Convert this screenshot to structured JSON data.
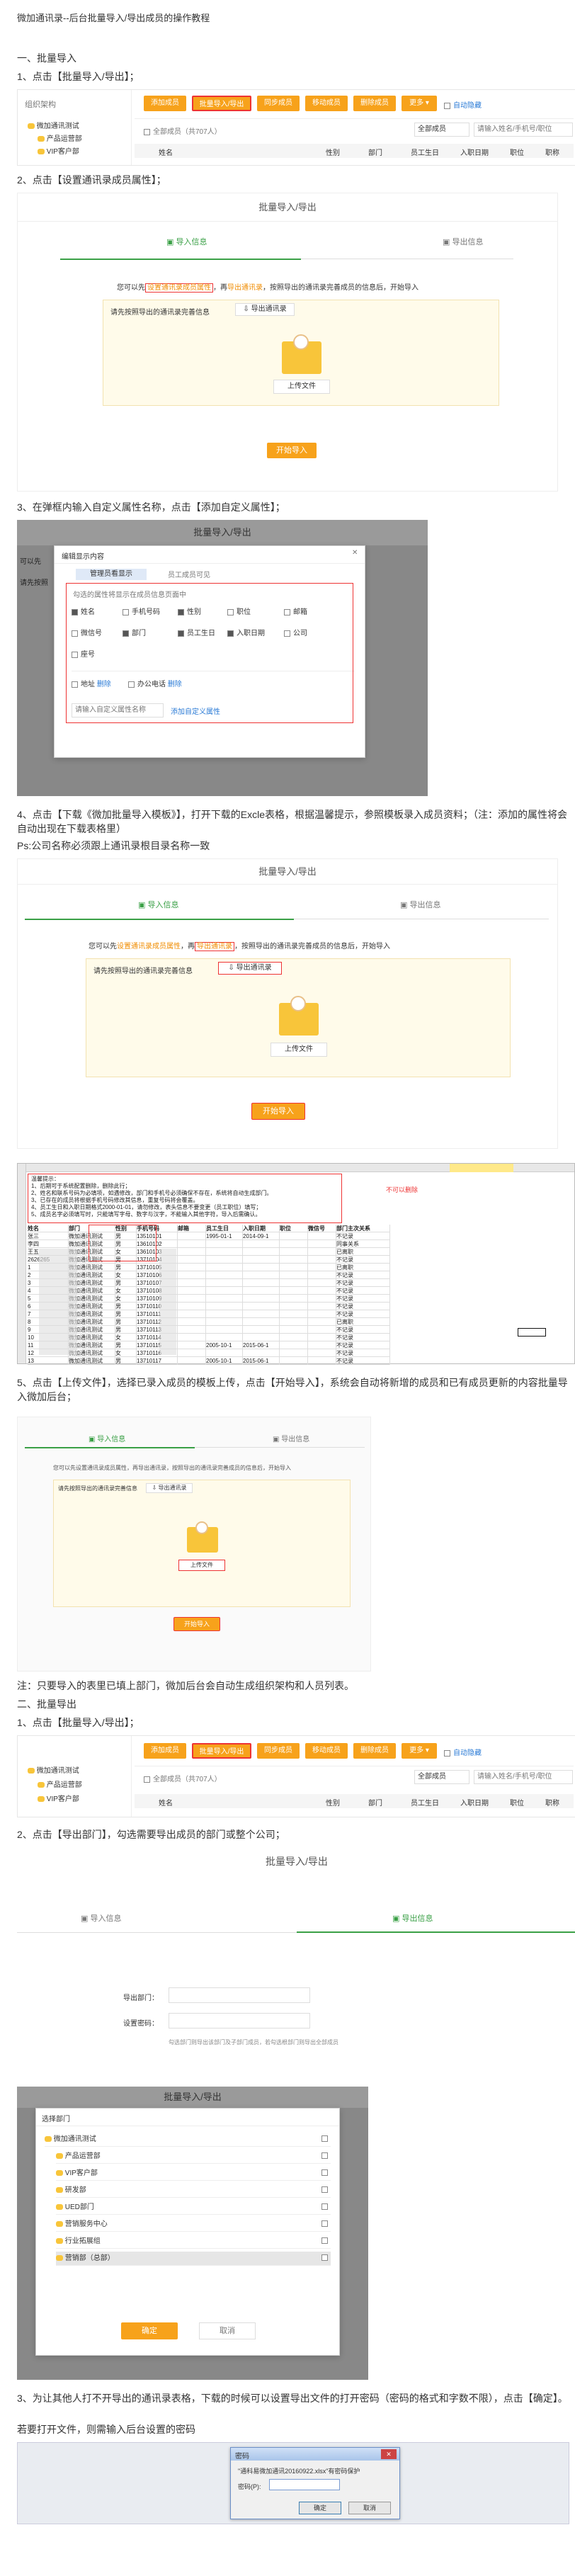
{
  "doc_title": "微加通讯录--后台批量导入/导出成员的操作教程",
  "s1": {
    "h": "一、批量导入",
    "step1": "1、点击【批量导入/导出】；",
    "step2": "2、点击【设置通讯录成员属性】；",
    "step3": "3、在弹框内输入自定义属性名称，点击【添加自定义属性】；",
    "step4": "4、点击【下载《微加批量导入模板》】，打开下载的Excle表格，根据温馨提示，参照模板录入成员资料；（注：添加的属性将会自动出现在下载表格里）",
    "ps": "Ps:公司名称必须跟上通讯录根目录名称一致",
    "step5": "5、点击【上传文件】，选择已录入成员的模板上传，点击【开始导入】，系统会自动将新增的成员和已有成员更新的内容批量导入微加后台；",
    "note": "注：只要导入的表里已填上部门，微加后台会自动生成组织架构和人员列表。"
  },
  "s2": {
    "h": "二、批量导出",
    "step1": "1、点击【批量导入/导出】；",
    "step2": "2、点击【导出部门】，勾选需要导出成员的部门或整个公司；",
    "step3": "3、为让其他人打不开导出的通讯录表格，下载的时候可以设置导出文件的打开密码（密码的格式和字数不限），点击【确定】。",
    "step4": "若要打开文件，则需输入后台设置的密码"
  },
  "toolbar": {
    "buttons": [
      "添加成员",
      "批量导入/导出",
      "同步成员",
      "移动成员",
      "删除成员",
      "更多 ▾"
    ],
    "checkbox": "自动隐藏",
    "org_label": "组织架构",
    "all_members": "全部成员（共707人）",
    "filter": "全部成员",
    "search_ph": "请输入姓名/手机号/职位",
    "cols": [
      "姓名",
      "性别",
      "部门",
      "员工生日",
      "入职日期",
      "职位",
      "职称"
    ]
  },
  "tree": [
    "微加通讯测试",
    "产品运营部",
    "VIP客户部"
  ],
  "dialog1": {
    "title": "批量导入/导出",
    "tab_import": "导入信息",
    "tab_export": "导出信息",
    "hint_pre": "您可以先",
    "hint_link": "设置通讯录成员属性",
    "hint_mid": "，再",
    "hint_link2": "导出通讯录",
    "hint_post": "，按照导出的通讯录完善成员的信息后，开始导入",
    "upload_hint": "请先按照导出的通讯录完善信息",
    "upload_btn": "导出通讯录",
    "upload_file": "上传文件",
    "start": "开始导入"
  },
  "dialog2": {
    "title": "批量导入/导出",
    "popup_title": "编辑显示内容",
    "tab1": "管理员看显示",
    "tab2": "员工成员可见",
    "desc": "勾选的属性将显示在成员信息页面中",
    "attrs": [
      "姓名",
      "手机号码",
      "性别",
      "职位",
      "邮箱",
      "微信号",
      "部门",
      "员工生日",
      "入职日期",
      "公司",
      "座号"
    ],
    "attrs2": [
      "地址",
      "删除",
      "办公电话",
      "删除"
    ],
    "input_ph": "请输入自定义属性名称",
    "add_btn": "添加自定义属性",
    "left_labels": [
      "可以先",
      "请先按照"
    ]
  },
  "dialog3": {
    "title": "批量导入/导出",
    "tab_import": "导入信息",
    "tab_export": "导出信息",
    "hint_pre": "您可以先",
    "hint_link": "设置通讯录成员属性",
    "hint_mid": "，再",
    "hint_link2": "导出通讯录",
    "hint_post": "，按照导出的通讯录完善成员的信息后，开始导入",
    "upload_hint": "请先按照导出的通讯录完善信息",
    "upload_btn": "导出通讯录",
    "upload_file": "上传文件",
    "start": "开始导入"
  },
  "excel": {
    "tip": "不可以删除",
    "note_lines": [
      "温馨提示：",
      "1、后期可于系统配置删除，删除此行；",
      "2、姓名和联系号码为必填项，如遇修改，部门和手机号必须确保不存在，系统将自动生成部门。",
      "3、已存在的成员将根据手机号码修改其信息，重复号码将会覆盖。",
      "4、员工生日和入职日期格式2000-01-01，请勿修改，表头信息不要变更（员工职位）填写；",
      "5、成员名字必须填写时，只能填写字母、数字与汉字，不能输入其他字符，导入后需确认。"
    ],
    "header": [
      "姓名",
      "部门",
      "性别",
      "手机号码",
      "邮箱",
      "员工生日",
      "入职日期",
      "职位",
      "微信号",
      "部门主次关系"
    ],
    "rows": [
      [
        "张三",
        "微加通讯测试",
        "男",
        "13510101",
        "",
        "1995-01-1",
        "2014-09-1",
        "",
        "",
        "不记录"
      ],
      [
        "李四",
        "微加通讯测试",
        "男",
        "13610102",
        "",
        "",
        "",
        "",
        "",
        "同事关系"
      ],
      [
        "王五",
        "微加通讯测试",
        "女",
        "13610103",
        "",
        "",
        "",
        "",
        "",
        "已离职"
      ],
      [
        "2626265",
        "微加通讯测试",
        "男",
        "13710104",
        "",
        "",
        "",
        "",
        "",
        "不记录"
      ],
      [
        "1",
        "微加通讯测试",
        "男",
        "13710105",
        "",
        "",
        "",
        "",
        "",
        "已离职"
      ],
      [
        "2",
        "微加通讯测试",
        "女",
        "13710106",
        "",
        "",
        "",
        "",
        "",
        "不记录"
      ],
      [
        "3",
        "微加通讯测试",
        "男",
        "13710107",
        "",
        "",
        "",
        "",
        "",
        "不记录"
      ],
      [
        "4",
        "微加通讯测试",
        "女",
        "13710108",
        "",
        "",
        "",
        "",
        "",
        "不记录"
      ],
      [
        "5",
        "微加通讯测试",
        "女",
        "13710109",
        "",
        "",
        "",
        "",
        "",
        "不记录"
      ],
      [
        "6",
        "微加通讯测试",
        "男",
        "13710110",
        "",
        "",
        "",
        "",
        "",
        "不记录"
      ],
      [
        "7",
        "微加通讯测试",
        "男",
        "13710111",
        "",
        "",
        "",
        "",
        "",
        "不记录"
      ],
      [
        "8",
        "微加通讯测试",
        "男",
        "13710112",
        "",
        "",
        "",
        "",
        "",
        "已离职"
      ],
      [
        "9",
        "微加通讯测试",
        "男",
        "13710113",
        "",
        "",
        "",
        "",
        "",
        "不记录"
      ],
      [
        "10",
        "微加通讯测试",
        "女",
        "13710114",
        "",
        "",
        "",
        "",
        "",
        "不记录"
      ],
      [
        "11",
        "微加通讯测试",
        "男",
        "13710115",
        "",
        "2005-10-1",
        "2015-06-1",
        "",
        "",
        "不记录"
      ],
      [
        "12",
        "微加通讯测试",
        "女",
        "13710116",
        "",
        "",
        "",
        "",
        "",
        "不记录"
      ],
      [
        "13",
        "微加通讯测试",
        "男",
        "13710117",
        "",
        "2005-10-1",
        "2015-06-1",
        "",
        "",
        "不记录"
      ]
    ]
  },
  "dialog4": {
    "tab_import": "导入信息",
    "tab_export": "导出信息",
    "hint": "您可以先设置通讯录成员属性，再导出通讯录，按照导出的通讯录完善成员的信息后，开始导入",
    "upload_hint": "请先按照导出的通讯录完善信息",
    "upload_btn": "导出通讯录",
    "upload_file": "上传文件",
    "start": "开始导入"
  },
  "export1": {
    "title": "批量导入/导出",
    "tab_import": "导入信息",
    "tab_export": "导出信息",
    "dept_label": "导出部门：",
    "pwd_label": "设置密码：",
    "note": "勾选部门则导出该部门及子部门成员，若勾选根部门则导出全部成员"
  },
  "export2": {
    "title": "批量导入/导出",
    "popup_title": "选择部门",
    "depts": [
      "微加通讯测试",
      "产品运营部",
      "VIP客户部",
      "研发部",
      "UED部门",
      "营销服务中心",
      "行业拓展组",
      "营销部（总部）"
    ],
    "ok": "确定",
    "cancel": "取消"
  },
  "pwd": {
    "title": "密码",
    "msg": "\"通科易微加通讯20160922.xlsx\"有密码保护",
    "label": "密码(P):",
    "ok": "确定",
    "cancel": "取消"
  }
}
